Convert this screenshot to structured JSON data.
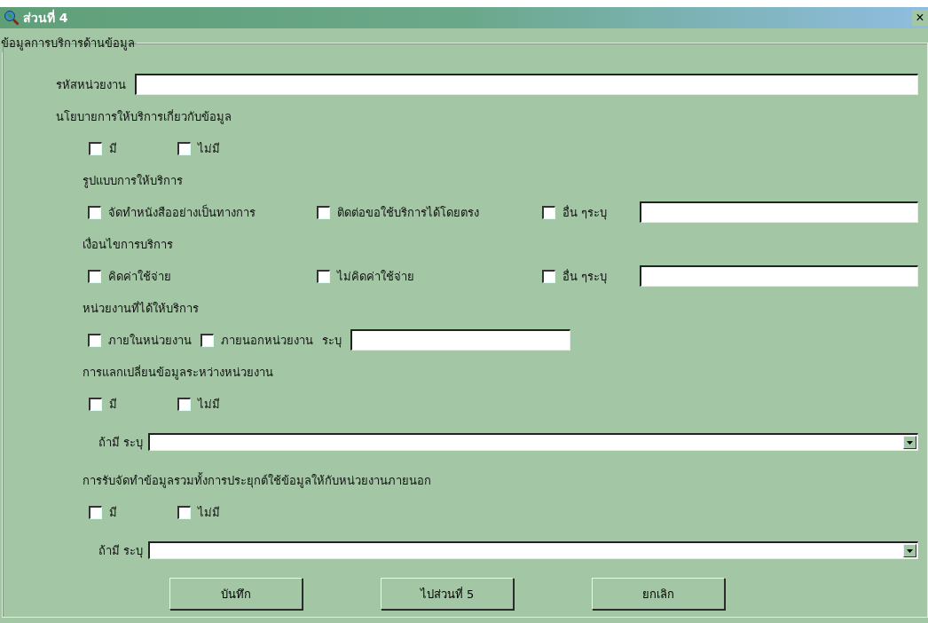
{
  "window": {
    "title": "ส่วนที่ 4",
    "close": "×"
  },
  "group": {
    "title": "ข้อมูลการบริการด้านข้อมูล"
  },
  "rows": [
    {
      "kind": "field",
      "label": "รหัสหน่วยงาน"
    },
    {
      "kind": "heading",
      "text": "นโยบายการให้บริการเกี่ยวกับข้อมูล"
    },
    {
      "kind": "choices",
      "items": [
        {
          "kind": "check",
          "label": "มี",
          "checked": false
        },
        {
          "kind": "check",
          "label": "ไม่มี",
          "checked": false
        }
      ]
    },
    {
      "kind": "subheading",
      "text": "รูปแบบการให้บริการ"
    },
    {
      "kind": "options",
      "items": [
        {
          "kind": "check",
          "label": "จัดทำหนังสืออย่างเป็นทางการ",
          "checked": false
        },
        {
          "kind": "check",
          "label": "ติดต่อขอใช้บริการได้โดยตรง",
          "checked": false
        },
        {
          "kind": "check",
          "label": "อื่น ๆระบุ",
          "checked": false
        },
        {
          "kind": "input"
        }
      ]
    },
    {
      "kind": "subheading",
      "text": "เงื่อนไขการบริการ"
    },
    {
      "kind": "options",
      "items": [
        {
          "kind": "check",
          "label": "คิดค่าใช้จ่าย",
          "checked": false
        },
        {
          "kind": "check",
          "label": "ไม่คิดค่าใช้จ่าย",
          "checked": false
        },
        {
          "kind": "check",
          "label": "อื่น ๆระบุ",
          "checked": false
        },
        {
          "kind": "input"
        }
      ]
    },
    {
      "kind": "subheading",
      "text": "หน่วยงานที่ได้ให้บริการ"
    },
    {
      "kind": "inline",
      "items": [
        {
          "kind": "check",
          "label": "ภายในหน่วยงาน",
          "checked": false
        },
        {
          "kind": "check",
          "label": "ภายนอกหน่วยงาน",
          "checked": false
        },
        {
          "kind": "label",
          "text": "ระบุ"
        },
        {
          "kind": "input"
        }
      ]
    },
    {
      "kind": "subheading",
      "text": "การแลกเปลี่ยนข้อมูลระหว่างหน่วยงาน"
    },
    {
      "kind": "choices",
      "items": [
        {
          "kind": "check",
          "label": "มี",
          "checked": false
        },
        {
          "kind": "check",
          "label": "ไม่มี",
          "checked": false
        }
      ]
    },
    {
      "kind": "combo",
      "label": "ถ้ามี ระบุ"
    },
    {
      "kind": "subheading",
      "text": "การรับจัดทำข้อมูลรวมทั้งการประยุกต์ใช้ข้อมูลให้กับหน่วยงานภายนอก"
    },
    {
      "kind": "choices",
      "items": [
        {
          "kind": "check",
          "label": "มี",
          "checked": false
        },
        {
          "kind": "check",
          "label": "ไม่มี",
          "checked": false
        }
      ]
    },
    {
      "kind": "combo",
      "label": "ถ้ามี ระบุ"
    }
  ],
  "buttons": [
    "บันทึก",
    "ไปส่วนที่ 5",
    "ยกเลิก"
  ]
}
